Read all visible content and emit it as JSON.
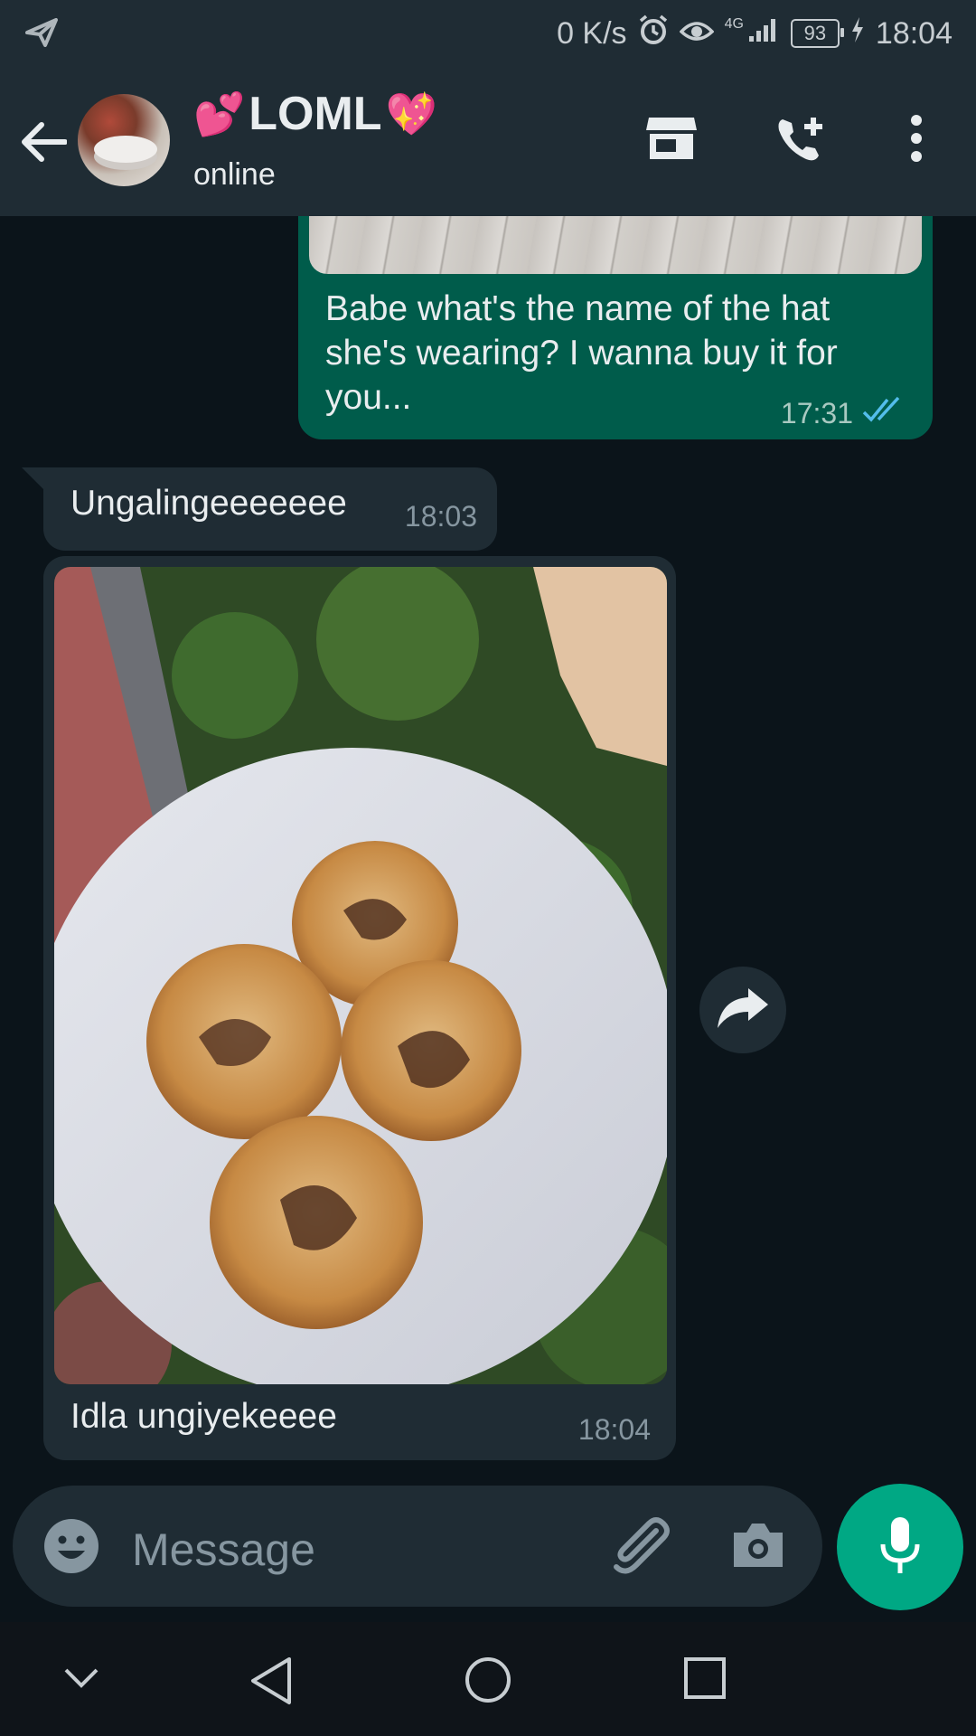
{
  "status_bar": {
    "network_speed": "0 K/s",
    "network_type": "4G",
    "battery": "93",
    "time": "18:04"
  },
  "header": {
    "contact_name": "LOML",
    "contact_emoji_left": "💕",
    "contact_emoji_right": "💖",
    "status": "online"
  },
  "messages": [
    {
      "direction": "outgoing",
      "text": "Babe what's the name of the hat she's wearing? I wanna buy it for you...",
      "time": "17:31",
      "receipt": "read"
    },
    {
      "direction": "incoming",
      "text": "Ungalingeeeeeee",
      "time": "18:03"
    },
    {
      "direction": "incoming",
      "type": "image",
      "caption": "Idla ungiyekeeee",
      "time": "18:04"
    }
  ],
  "composer": {
    "placeholder": "Message"
  },
  "colors": {
    "app_bar": "#1f2c34",
    "chat_bg": "#0b141a",
    "outgoing_bubble": "#005c4b",
    "incoming_bubble": "#1f2c34",
    "accent": "#00a884",
    "read_tick": "#53bdeb"
  },
  "icons": {
    "status_left": "telegram-send-icon",
    "alarm": "alarm-icon",
    "eye": "eye-comfort-icon",
    "signal": "signal-icon",
    "charging": "charging-bolt-icon",
    "back": "back-arrow-icon",
    "store": "store-icon",
    "call_add": "add-call-icon",
    "menu": "more-vert-icon",
    "emoji": "emoji-icon",
    "attach": "paperclip-icon",
    "camera": "camera-icon",
    "mic": "mic-icon",
    "forward": "forward-icon"
  }
}
